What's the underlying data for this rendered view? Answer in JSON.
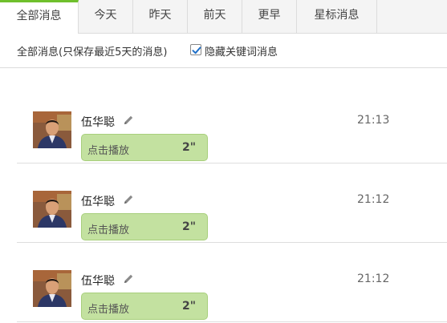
{
  "tabs": [
    {
      "label": "全部消息",
      "active": true
    },
    {
      "label": "今天",
      "active": false
    },
    {
      "label": "昨天",
      "active": false
    },
    {
      "label": "前天",
      "active": false
    },
    {
      "label": "更早",
      "active": false
    },
    {
      "label": "星标消息",
      "active": false
    }
  ],
  "filter": {
    "label": "全部消息(只保存最近5天的消息)",
    "hide_keyword_checked": true,
    "hide_keyword_label": "隐藏关键词消息"
  },
  "messages": [
    {
      "sender": "伍华聪",
      "time": "21:13",
      "voice_label": "点击播放",
      "duration": "2\""
    },
    {
      "sender": "伍华聪",
      "time": "21:12",
      "voice_label": "点击播放",
      "duration": "2\""
    },
    {
      "sender": "伍华聪",
      "time": "21:12",
      "voice_label": "点击播放",
      "duration": "2\""
    }
  ],
  "icons": {
    "edit": "pencil-icon",
    "checkbox": "checkmark-icon"
  },
  "colors": {
    "accent": "#6fc02c",
    "voice_bubble": "#c3e1a0",
    "voice_border": "#a8cf7c"
  }
}
